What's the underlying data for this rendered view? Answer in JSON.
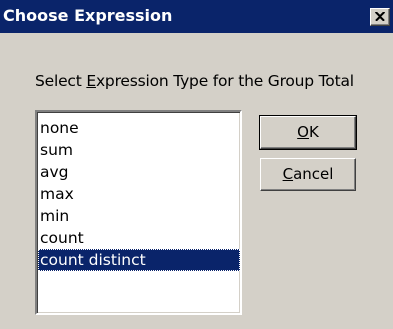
{
  "window": {
    "title": "Choose Expression",
    "close_icon": "close-icon"
  },
  "dialog": {
    "prompt_before": "Select ",
    "prompt_mnemonic": "E",
    "prompt_after": "xpression Type for the Group Total"
  },
  "list": {
    "items": [
      "none",
      "sum",
      "avg",
      "max",
      "min",
      "count",
      "count distinct"
    ],
    "selected": "count distinct"
  },
  "buttons": {
    "ok_mnemonic": "O",
    "ok_rest": "K",
    "cancel_mnemonic": "C",
    "cancel_rest": "ancel"
  },
  "colors": {
    "titlebar": "#0a246a",
    "selection": "#0a246a",
    "face": "#d4d0c8"
  }
}
